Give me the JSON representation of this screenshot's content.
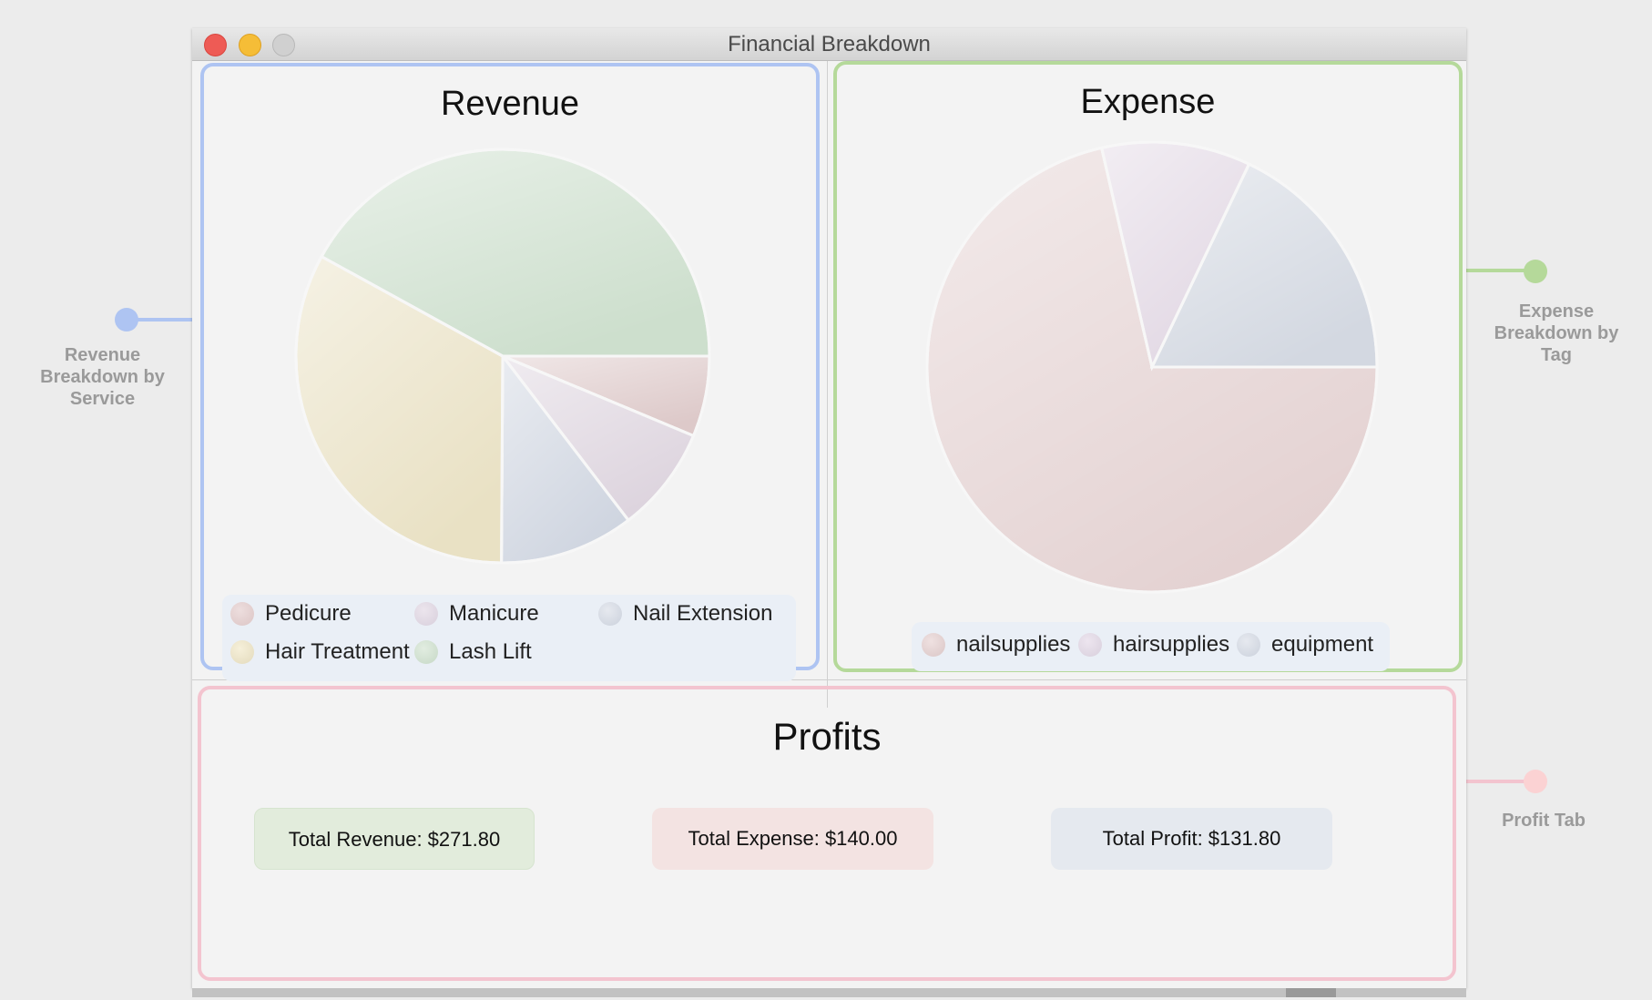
{
  "window": {
    "title": "Financial Breakdown"
  },
  "revenue": {
    "title": "Revenue",
    "chart_data": {
      "type": "pie",
      "categories": [
        "Pedicure",
        "Manicure",
        "Nail Extension",
        "Hair Treatment",
        "Lash Lift"
      ],
      "values": [
        6.3,
        8.3,
        10.5,
        32.9,
        42.0
      ],
      "colors": [
        "#ddc9c9",
        "#ddd4de",
        "#cfd5e0",
        "#e9e1c4",
        "#cddfcd"
      ]
    }
  },
  "expense": {
    "title": "Expense",
    "chart_data": {
      "type": "pie",
      "categories": [
        "nailsupplies",
        "hairsupplies",
        "equipment"
      ],
      "values": [
        71.4,
        10.7,
        17.9
      ],
      "colors": [
        "#e4d2d2",
        "#e2d8e4",
        "#d3d8e1"
      ]
    }
  },
  "profits": {
    "title": "Profits",
    "total_revenue": "Total Revenue: $271.80",
    "total_expense": "Total Expense: $140.00",
    "total_profit": "Total Profit: $131.80"
  },
  "annotations": {
    "revenue": "Revenue Breakdown by Service",
    "expense": "Expense Breakdown by Tag",
    "profit": "Profit Tab"
  },
  "accent_colors": {
    "revenue": "#aec4f2",
    "expense": "#b5d99a",
    "profit": "#f3c4cf"
  }
}
